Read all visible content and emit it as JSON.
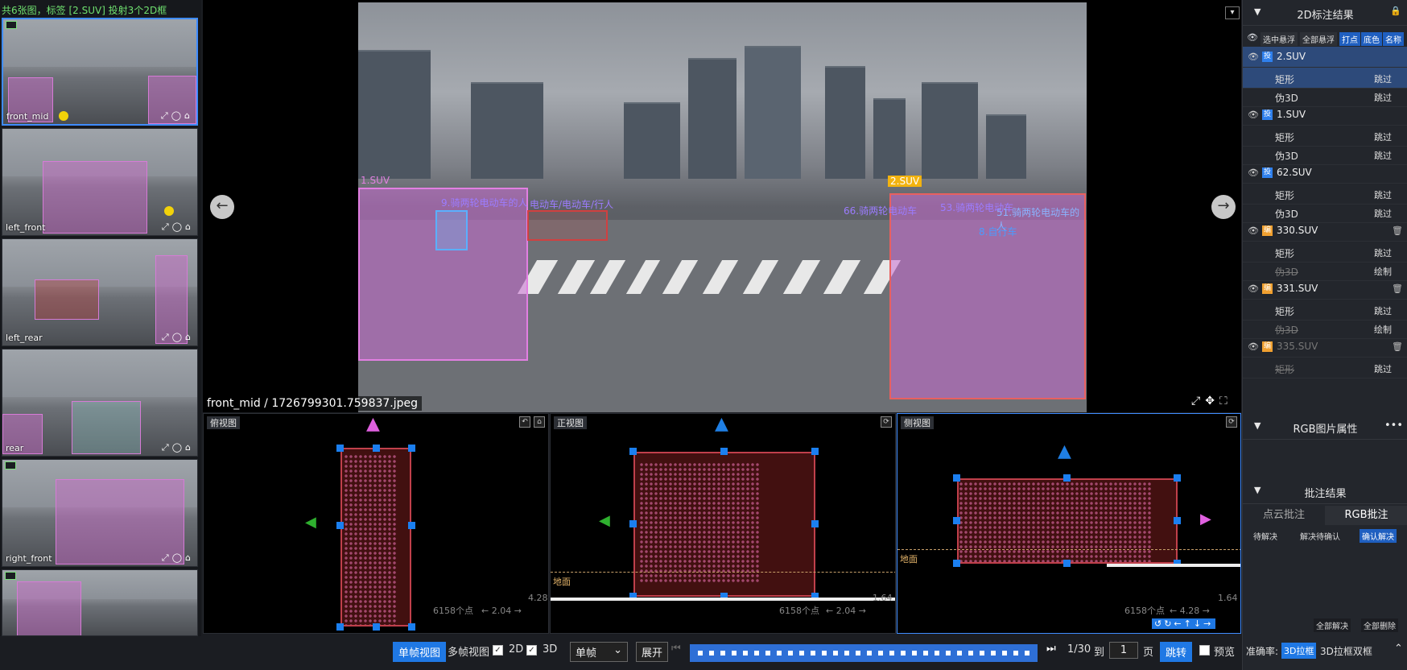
{
  "thumbs": {
    "header": "共6张图，标签 [2.SUV] 投射3个2D框",
    "items": [
      {
        "name": "front_mid"
      },
      {
        "name": "left_front"
      },
      {
        "name": "left_rear"
      },
      {
        "name": "rear"
      },
      {
        "name": "right_front"
      },
      {
        "name": ""
      }
    ]
  },
  "main": {
    "caption": "front_mid / 1726799301.759837.jpeg",
    "labels": {
      "suv1": "1.SUV",
      "suv2": "2.SUV",
      "l9": "9.骑两轮电动车的人",
      "l51": "51.骑两轮电动车的人",
      "l66": "66.骑两轮电动车",
      "l8": "8.自行车",
      "l53": "53.骑两轮电动车",
      "lrow": "电动车/电动车/行人"
    }
  },
  "views": {
    "top": {
      "title": "俯视图",
      "count": "6158个点",
      "dim1": "← 2.04 →",
      "dim2": "4.28"
    },
    "front": {
      "title": "正视图",
      "count": "6158个点",
      "dim1": "← 2.04 →",
      "dim2": "1.64",
      "ground": "地面"
    },
    "side": {
      "title": "侧视图",
      "count": "6158个点",
      "dim1": "← 4.28 →",
      "dim2": "1.64",
      "ground": "地面"
    }
  },
  "bottom": {
    "single_view": "单帧视图",
    "multi_view": "多帧视图",
    "check_2d": "2D",
    "check_3d": "3D",
    "frame_select": "单帧",
    "expand": "展开",
    "page_info": "1/30",
    "to": "到",
    "page_input": "1",
    "page_unit": "页",
    "jump": "跳转",
    "preview": "预览",
    "accuracy_label": "准确率:",
    "mode_active": "3D拉框",
    "mode_other": "3D拉框双框"
  },
  "right": {
    "title": "2D标注结果",
    "toolbar": [
      "选中悬浮",
      "全部悬浮",
      "打点",
      "底色",
      "名称"
    ],
    "items": [
      {
        "name": "2.SUV",
        "badge": "投",
        "color": "#2f80ed",
        "rows": [
          [
            "矩形",
            "跳过"
          ],
          [
            "伪3D",
            "跳过"
          ]
        ]
      },
      {
        "name": "1.SUV",
        "badge": "投",
        "color": "#2f80ed",
        "rows": [
          [
            "矩形",
            "跳过"
          ],
          [
            "伪3D",
            "跳过"
          ]
        ]
      },
      {
        "name": "62.SUV",
        "badge": "投",
        "color": "#2f80ed",
        "rows": [
          [
            "矩形",
            "跳过"
          ],
          [
            "伪3D",
            "跳过"
          ]
        ]
      },
      {
        "name": "330.SUV",
        "badge": "编",
        "color": "#f0a030",
        "rows": [
          [
            "矩形",
            "跳过"
          ],
          [
            "伪3D",
            "绘制"
          ]
        ]
      },
      {
        "name": "331.SUV",
        "badge": "编",
        "color": "#f0a030",
        "rows": [
          [
            "矩形",
            "跳过"
          ],
          [
            "伪3D",
            "绘制"
          ]
        ]
      },
      {
        "name": "335.SUV",
        "badge": "编",
        "color": "#f0a030",
        "rows": [
          [
            "矩形",
            "跳过"
          ]
        ]
      }
    ],
    "rgb_title": "RGB图片属性",
    "more": "•••",
    "review_title": "批注结果",
    "tab_cloud": "点云批注",
    "tab_rgb": "RGB批注",
    "filters": [
      "待解决",
      "解决待确认",
      "确认解决"
    ],
    "resolve_all": "全部解决",
    "delete_all": "全部删除"
  }
}
